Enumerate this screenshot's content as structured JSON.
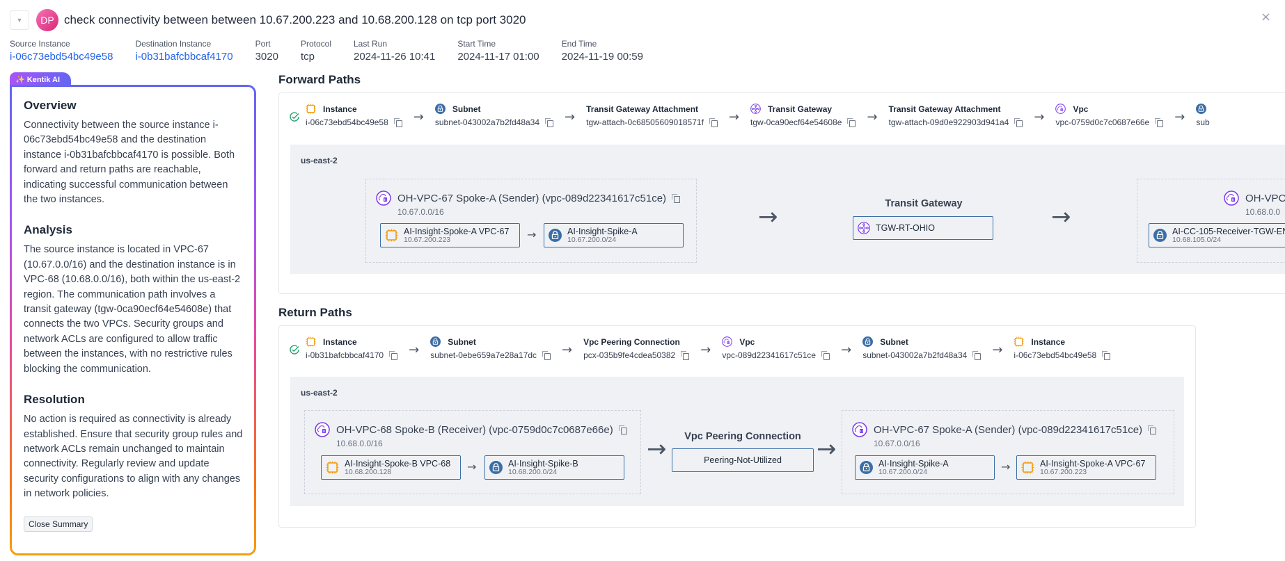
{
  "header": {
    "collapse_icon": "caret-down-icon",
    "avatar_initials": "DP",
    "title": "check connectivity between between 10.67.200.223 and 10.68.200.128 on tcp port 3020",
    "close_glyph": "×"
  },
  "meta": [
    {
      "label": "Source Instance",
      "value": "i-06c73ebd54bc49e58",
      "link": true
    },
    {
      "label": "Destination Instance",
      "value": "i-0b31bafcbbcaf4170",
      "link": true
    },
    {
      "label": "Port",
      "value": "3020",
      "link": false
    },
    {
      "label": "Protocol",
      "value": "tcp",
      "link": false
    },
    {
      "label": "Last Run",
      "value": "2024-11-26 10:41",
      "link": false
    },
    {
      "label": "Start Time",
      "value": "2024-11-17 01:00",
      "link": false
    },
    {
      "label": "End Time",
      "value": "2024-11-19 00:59",
      "link": false
    }
  ],
  "ai_summary": {
    "tab_label": "✨ Kentik AI",
    "sections": [
      {
        "heading": "Overview",
        "body": "Connectivity between the source instance i-06c73ebd54bc49e58 and the destination instance i-0b31bafcbbcaf4170 is possible. Both forward and return paths are reachable, indicating successful communication between the two instances."
      },
      {
        "heading": "Analysis",
        "body": "The source instance is located in VPC-67 (10.67.0.0/16) and the destination instance is in VPC-68 (10.68.0.0/16), both within the us-east-2 region. The communication path involves a transit gateway (tgw-0ca90ecf64e54608e) that connects the two VPCs. Security groups and network ACLs are configured to allow traffic between the instances, with no restrictive rules blocking the communication."
      },
      {
        "heading": "Resolution",
        "body": "No action is required as connectivity is already established. Ensure that security group rules and network ACLs remain unchanged to maintain connectivity. Regularly review and update security configurations to align with any changes in network policies."
      }
    ],
    "close_button": "Close Summary"
  },
  "forward": {
    "title": "Forward Paths",
    "status": "reachable",
    "hops": [
      {
        "type": "Instance",
        "icon": "instance-icon",
        "id": "i-06c73ebd54bc49e58"
      },
      {
        "type": "Subnet",
        "icon": "subnet-lock-icon",
        "id": "subnet-043002a7b2fd48a34"
      },
      {
        "type": "Transit Gateway Attachment",
        "icon": "",
        "id": "tgw-attach-0c68505609018571f"
      },
      {
        "type": "Transit Gateway",
        "icon": "transit-gateway-icon",
        "id": "tgw-0ca90ecf64e54608e"
      },
      {
        "type": "Transit Gateway Attachment",
        "icon": "",
        "id": "tgw-attach-09d0e922903d941a4"
      },
      {
        "type": "Vpc",
        "icon": "vpc-icon",
        "id": "vpc-0759d0c7c0687e66e"
      },
      {
        "type": "",
        "icon": "subnet-lock-icon",
        "id": "sub"
      }
    ],
    "region": "us-east-2",
    "src_vpc": {
      "title": "OH-VPC-67 Spoke-A (Sender) (vpc-089d22341617c51ce)",
      "cidr": "10.67.0.0/16",
      "nodes": [
        {
          "icon": "instance-icon",
          "name": "AI-Insight-Spoke-A VPC-67",
          "sub": "10.67.200.223"
        },
        {
          "icon": "subnet-lock-icon",
          "name": "AI-Insight-Spike-A",
          "sub": "10.67.200.0/24"
        }
      ]
    },
    "middle": {
      "title": "Transit Gateway",
      "node": "TGW-RT-OHIO"
    },
    "dst_vpc": {
      "title": "OH-VPC",
      "cidr": "10.68.0.0",
      "nodes": [
        {
          "icon": "subnet-lock-icon",
          "name": "AI-CC-105-Receiver-TGW-EN",
          "sub": "10.68.105.0/24"
        }
      ]
    }
  },
  "return": {
    "title": "Return Paths",
    "status": "reachable",
    "hops": [
      {
        "type": "Instance",
        "icon": "instance-icon",
        "id": "i-0b31bafcbbcaf4170"
      },
      {
        "type": "Subnet",
        "icon": "subnet-lock-icon",
        "id": "subnet-0ebe659a7e28a17dc"
      },
      {
        "type": "Vpc Peering Connection",
        "icon": "",
        "id": "pcx-035b9fe4cdea50382"
      },
      {
        "type": "Vpc",
        "icon": "vpc-icon",
        "id": "vpc-089d22341617c51ce"
      },
      {
        "type": "Subnet",
        "icon": "subnet-lock-icon",
        "id": "subnet-043002a7b2fd48a34"
      },
      {
        "type": "Instance",
        "icon": "instance-icon",
        "id": "i-06c73ebd54bc49e58"
      }
    ],
    "region": "us-east-2",
    "src_vpc": {
      "title": "OH-VPC-68 Spoke-B (Receiver) (vpc-0759d0c7c0687e66e)",
      "cidr": "10.68.0.0/16",
      "nodes": [
        {
          "icon": "instance-icon",
          "name": "AI-Insight-Spoke-B VPC-68",
          "sub": "10.68.200.128"
        },
        {
          "icon": "subnet-lock-icon",
          "name": "AI-Insight-Spike-B",
          "sub": "10.68.200.0/24"
        }
      ]
    },
    "middle": {
      "title": "Vpc Peering Connection",
      "node": "Peering-Not-Utilized"
    },
    "dst_vpc": {
      "title": "OH-VPC-67 Spoke-A (Sender) (vpc-089d22341617c51ce)",
      "cidr": "10.67.0.0/16",
      "nodes": [
        {
          "icon": "subnet-lock-icon",
          "name": "AI-Insight-Spike-A",
          "sub": "10.67.200.0/24"
        },
        {
          "icon": "instance-icon",
          "name": "AI-Insight-Spoke-A VPC-67",
          "sub": "10.67.200.223"
        }
      ]
    }
  },
  "colors": {
    "link": "#2563eb",
    "success": "#22a06b",
    "instance_orange": "#f59e0b",
    "subnet_blue": "#3b6ea5",
    "vpc_purple": "#7c3aed",
    "region_bg": "#eff1f5"
  }
}
